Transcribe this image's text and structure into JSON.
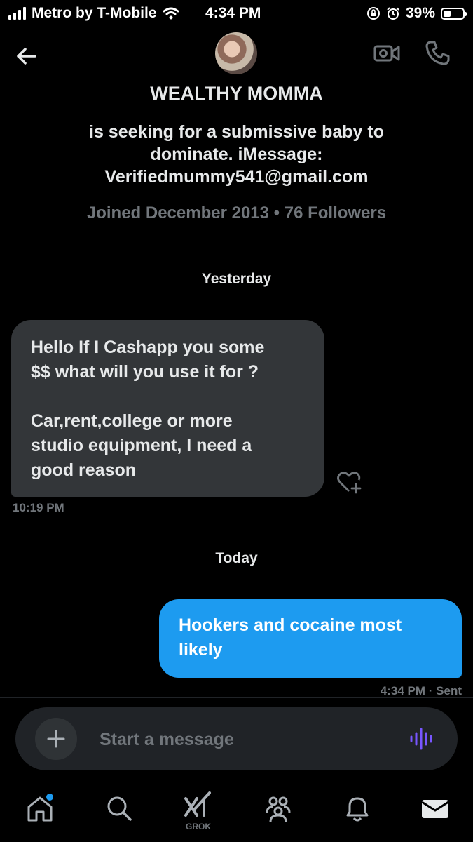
{
  "status_bar": {
    "carrier": "Metro by T-Mobile",
    "time": "4:34 PM",
    "battery": "39%",
    "battery_level": 0.39
  },
  "header": {
    "contact_name": "WEALTHY MOMMA"
  },
  "profile": {
    "bio_lines": [
      "is seeking for a submissive baby to",
      "dominate. iMessage:",
      "Verifiedmummy541@gmail.com"
    ],
    "joined": "Joined December 2013 • 76 Followers"
  },
  "conversation": {
    "day1_label": "Yesterday",
    "incoming": {
      "text": "Hello If I Cashapp you some\n$$ what will you use it for ?\n\nCar,rent,college or more\nstudio equipment,  I need a\ngood reason",
      "time": "10:19 PM"
    },
    "day2_label": "Today",
    "outgoing": {
      "text": "Hookers and cocaine most likely",
      "time": "4:34 PM · Sent"
    }
  },
  "composer": {
    "placeholder": "Start a message"
  },
  "tabbar": {
    "grok_label": "GROK"
  },
  "colors": {
    "accent": "#1d9bf0",
    "incoming_bubble": "#333639",
    "voice": "#7856ff",
    "muted": "#71767b"
  }
}
